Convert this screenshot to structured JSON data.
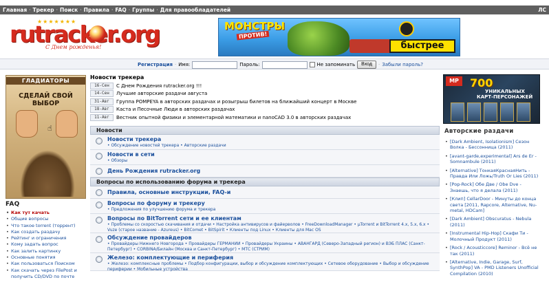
{
  "topbar": {
    "links": [
      "Главная",
      "Трекер",
      "Поиск",
      "Правила",
      "FAQ",
      "Группы",
      "Для правообладателей"
    ],
    "right": "ЛС"
  },
  "logo": {
    "brand": "rutracker.org",
    "slogan": "С Днем рожденья!"
  },
  "banner_top": {
    "line1": "МОНСТРЫ",
    "line2": "ПРОТИВ!",
    "cta": "быстрее"
  },
  "login": {
    "register": "Регистрация",
    "name_label": "Имя:",
    "password_label": "Пароль:",
    "remember": "Не запоминать",
    "enter": "Вход",
    "forgot": "Забыли пароль?"
  },
  "ad_left": {
    "header": "ГЛАДИАТОРЫ",
    "slogan": "СДЕЛАЙ СВОЙ ВЫБОР"
  },
  "faq": {
    "title": "FAQ",
    "items": [
      "Как тут качать",
      "Общие вопросы",
      "Что такое torrent (торрент)",
      "Как создать раздачу",
      "Рейтинг и ограничения",
      "Кому задать вопрос",
      "Как залить картинку",
      "Основные понятия",
      "Как пользоваться Поиском",
      "Как скачать через FilePost и получить CD/DVD по почте"
    ]
  },
  "news": {
    "title": "Новости трекера",
    "items": [
      {
        "date": "16-Сен",
        "text": "С Днем Рождения rutracker.org !!!"
      },
      {
        "date": "14-Сен",
        "text": "Лучшие авторские раздачи августа"
      },
      {
        "date": "31-Авг",
        "text": "Группа POMPEYA в авторских раздачах и розыгрыш билетов на ближайший концерт в Москве"
      },
      {
        "date": "18-Авг",
        "text": "Каста и Песочные Люди в авторских раздачах"
      },
      {
        "date": "11-Авг",
        "text": "Вестник опытной физики и элементарной математики и nanoCAD 3.0 в авторских раздачах"
      }
    ]
  },
  "forum": {
    "section1": "Новости",
    "section1_rows": [
      {
        "name": "Новости трекера",
        "sub": "• Обсуждение новостей трекера • Авторские раздачи"
      },
      {
        "name": "Новости в сети",
        "sub": "• Обзоры"
      },
      {
        "name": "День Рождения rutracker.org",
        "sub": ""
      }
    ],
    "section2": "Вопросы по использованию форума и трекера",
    "section2_rows": [
      {
        "name": "Правила, основные инструкции, FAQ-и",
        "sub": ""
      },
      {
        "name": "Вопросы по форуму и трекеру",
        "sub": "• Предложения по улучшению форума и трекера"
      },
      {
        "name": "Вопросы по BitTorrent сети и ее клиентам",
        "sub": "• Проблемы со скоростью скачивания и отдачи • Настройка антивирусов и файерволов • FreeDownloadManager • µTorrent и BitTorrent 4.x, 5.x, 6.x • Vuze (старое название - Azureus) • BitComet • BitSpirit • Клиенты под Linux • Клиенты для Mac OS"
      },
      {
        "name": "Обсуждение провайдеров",
        "sub": "• Провайдеры Нижнего Новгорода • Провайдеры ГЕРМАНИИ • Провайдеры Украины • АВАНГАРД (Северо-Западный регион) и ВЭБ ПЛАС (Санкт-Петербург) • CORBINA/Билайн (Москва и Санкт-Петербург) • МТС (СТРИМ)"
      },
      {
        "name": "Железо: комплектующие и периферия",
        "sub": "• Железо: комплексные проблемы • Подбор конфигурации, выбор и обсуждение комплектующих • Сетевое оборудование • Выбор и обсуждение периферии • Мобильные устройства"
      }
    ]
  },
  "ad_right": {
    "big": "700",
    "line1": "УНИКАЛЬНЫХ",
    "line2": "КАРТ-ПЕРСОНАЖЕЙ",
    "badge": "MP"
  },
  "authors": {
    "title": "Авторские раздачи",
    "items": [
      "[Dark Ambient, Isolationism] Сезон Волка - Бессонница (2011)",
      "[avant-garde,experimental] Ars de Er - Somnambule (2011)",
      "[Alternative] ТонкаяКраснаяНить - Правда Или Ложь/Truth Or Lies (2011)",
      "[Pop-Rock] Обе Две / Obe Dve - Знаешь, что я делала (2011)",
      "[Клип] CellarDoor - Минуты до конца света [2011, Rapcore, Alternative, Nu-metal, HDCam]",
      "[Dark Ambient] Obscuratus - Nebula (2011)",
      "[Instrumental Hip-Hop] Скафи Ти - Молочный Продукт (2011)",
      "[Rock / Acousticcore] Reminor - Всё не так (2011)",
      "[Alternative, Indie, Garage, Surf, SynthPop] VA - PMD Listeners Unofficial Compilation (2010)"
    ]
  }
}
